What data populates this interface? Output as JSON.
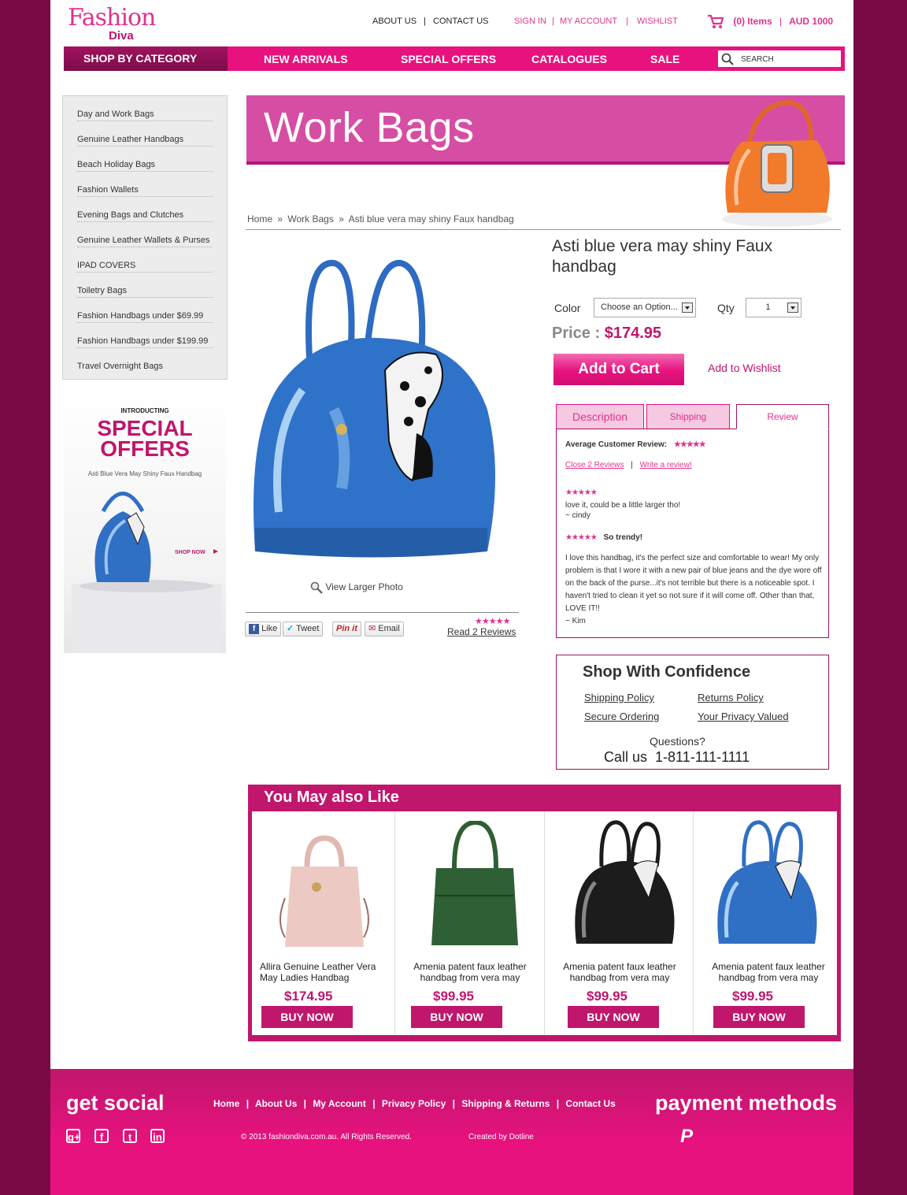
{
  "header": {
    "logo_line1": "Fashion",
    "logo_line2": "Diva",
    "about_us": "ABOUT US",
    "contact_us": "CONTACT US",
    "sep": "|",
    "sign_in": "SIGN IN",
    "my_account": "MY ACCOUNT",
    "wishlist": "WISHLIST",
    "cart_items": "(0) Items",
    "cart_total": "AUD 1000"
  },
  "nav": {
    "shop_by_category": "SHOP BY CATEGORY",
    "items": [
      "NEW ARRIVALS",
      "SPECIAL OFFERS",
      "CATALOGUES",
      "SALE"
    ],
    "search_placeholder": "SEARCH"
  },
  "sidebar": {
    "items": [
      "Day and Work Bags",
      "Genuine Leather Handbags",
      "Beach Holiday Bags",
      "Fashion Wallets",
      "Evening Bags and Clutches",
      "Genuine Leather Wallets & Purses",
      "IPAD COVERS",
      "Toiletry Bags",
      "Fashion Handbags under $69.99",
      "Fashion Handbags under $199.99",
      "Travel Overnight Bags"
    ]
  },
  "promo": {
    "introducing": "INTRODUCTING",
    "line1": "SPECIAL",
    "line2": "OFFERS",
    "sub": "Asti Blue Vera May Shiny Faux Handbag",
    "cta": "SHOP NOW"
  },
  "banner": {
    "title": "Work Bags"
  },
  "breadcrumb": {
    "home": "Home",
    "category": "Work Bags",
    "current": "Asti blue vera may shiny Faux handbag",
    "sep": "»"
  },
  "product": {
    "title": "Asti blue vera may shiny Faux handbag",
    "color_label": "Color",
    "color_value": "Choose an Option...",
    "qty_label": "Qty",
    "qty_value": "1",
    "price_label": "Price :",
    "price": "$174.95",
    "add_to_cart": "Add to Cart",
    "add_to_wishlist": "Add to Wishlist",
    "view_larger": "View Larger Photo",
    "read_reviews": "Read 2 Reviews",
    "rating_stars": 5
  },
  "share": {
    "like": "Like",
    "tweet": "Tweet",
    "pinit": "Pin it",
    "email": "Email"
  },
  "tabs": {
    "description": "Description",
    "shipping": "Shipping",
    "review": "Review",
    "active": "review"
  },
  "reviews": {
    "avg_label": "Average Customer Review:",
    "close_reviews": "Close 2 Reviews",
    "write_review": "Write a review!",
    "sep": "|",
    "items": [
      {
        "stars": 5,
        "title": "",
        "text": "love it, could be a little larger tho!",
        "author": "~ cindy"
      },
      {
        "stars": 5,
        "title": "So trendy!",
        "text": "I love this handbag, it's the perfect size and comfortable to wear! My only problem is that I wore it with a new pair of blue jeans and the dye wore off on the back of the purse...it's not terrible but there is a noticeable spot. I haven't tried to clean it yet so not sure if it will come off. Other than that, LOVE IT!!",
        "author": "~ Kim"
      }
    ]
  },
  "confidence": {
    "title": "Shop With Confidence",
    "shipping_policy": "Shipping Policy",
    "returns_policy": "Returns Policy",
    "secure_ordering": "Secure Ordering",
    "privacy": "Your Privacy Valued",
    "questions": "Questions?",
    "call": "Call us  1-811-111-1111"
  },
  "also_like": {
    "title": "You May also Like",
    "buy_label": "BUY NOW",
    "items": [
      {
        "name": "Allira Genuine Leather Vera May Ladies Handbag",
        "price": "$174.95",
        "color": "#e9c6c0"
      },
      {
        "name": "Amenia patent faux leather handbag from vera may",
        "price": "$99.95",
        "color": "#2f5f35"
      },
      {
        "name": "Amenia patent faux leather handbag from vera may",
        "price": "$99.95",
        "color": "#1c1c1c"
      },
      {
        "name": "Amenia patent faux leather handbag from vera may",
        "price": "$99.95",
        "color": "#2f6fc4"
      }
    ]
  },
  "footer": {
    "get_social": "get social",
    "payment_methods": "payment methods",
    "links": [
      "Home",
      "About Us",
      "My Account",
      "Privacy Policy",
      "Shipping & Returns",
      "Contact Us"
    ],
    "sep": "|",
    "copyright": "© 2013 fashiondiva.com.au. All Rights Reserved.",
    "created_by": "Created by Dotline"
  },
  "colors": {
    "brand_pink": "#e8127f",
    "brand_dark": "#a0135f",
    "price_pink": "#c0166c",
    "page_bg": "#7a0a45"
  }
}
